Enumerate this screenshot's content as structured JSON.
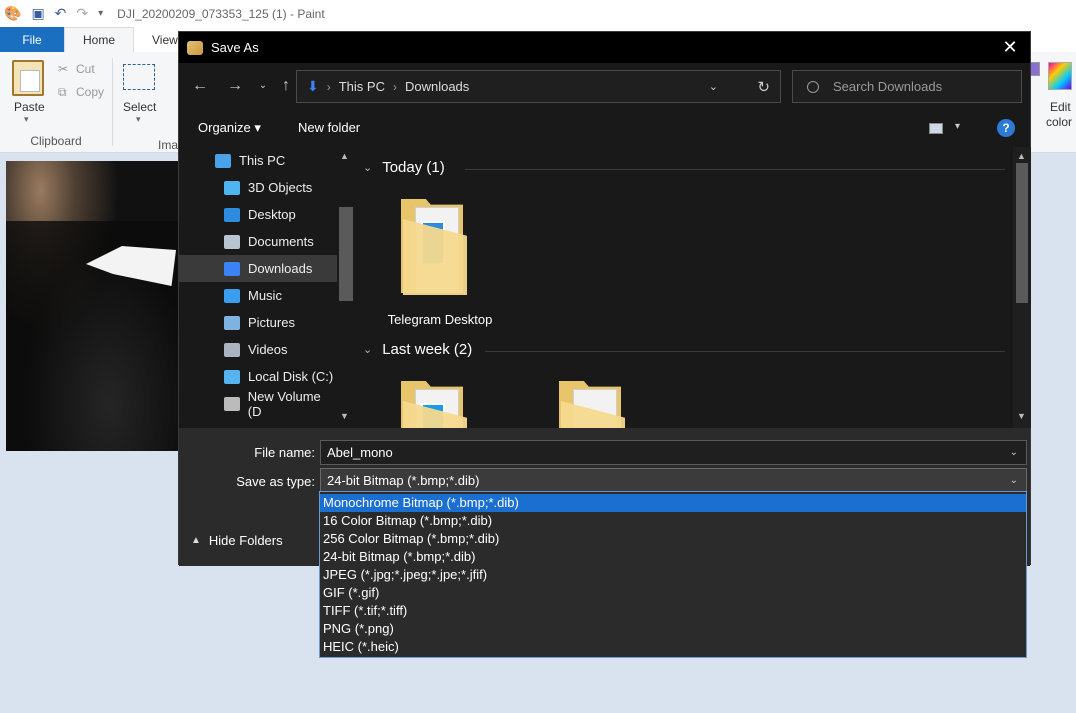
{
  "paint": {
    "title": "DJI_20200209_073353_125 (1) - Paint",
    "tabs": [
      {
        "label": "File"
      },
      {
        "label": "Home"
      },
      {
        "label": "View"
      }
    ],
    "clipboard": {
      "paste": "Paste",
      "cut": "Cut",
      "copy": "Copy",
      "group": "Clipboard"
    },
    "image": {
      "select": "Select",
      "group_partial": "Ima"
    },
    "edit_colors": [
      "Edit",
      "color"
    ]
  },
  "dialog": {
    "title": "Save As",
    "close_glyph": "✕",
    "breadcrumbs": [
      "This PC",
      "Downloads"
    ],
    "search_placeholder": "Search Downloads",
    "toolbar": {
      "organize": "Organize ▾",
      "new_folder": "New folder",
      "help": "?"
    },
    "nav_items": [
      {
        "label": "This PC",
        "icon": "computer-icon",
        "color": "#4aa3e8"
      },
      {
        "label": "3D Objects",
        "icon": "cube-icon",
        "color": "#4fb5f0"
      },
      {
        "label": "Desktop",
        "icon": "desktop-icon",
        "color": "#2d8be0"
      },
      {
        "label": "Documents",
        "icon": "document-icon",
        "color": "#b8c4d0"
      },
      {
        "label": "Downloads",
        "icon": "download-icon",
        "color": "#3b82f6"
      },
      {
        "label": "Music",
        "icon": "music-icon",
        "color": "#3b9cf0"
      },
      {
        "label": "Pictures",
        "icon": "pictures-icon",
        "color": "#7fb2e0"
      },
      {
        "label": "Videos",
        "icon": "video-icon",
        "color": "#aab4c0"
      },
      {
        "label": "Local Disk (C:)",
        "icon": "drive-icon",
        "color": "#55b4f0"
      },
      {
        "label": "New Volume (D",
        "icon": "drive-icon",
        "color": "#bbbbbb"
      }
    ],
    "groups": [
      {
        "header": "Today (1)",
        "items": [
          {
            "label": "Telegram Desktop"
          }
        ]
      },
      {
        "header": "Last week (2)",
        "items": [
          {
            "label": ""
          },
          {
            "label": ""
          }
        ]
      }
    ],
    "file_name_label": "File name:",
    "file_name_value": "Abel_mono",
    "save_type_label": "Save as type:",
    "save_type_value": "24-bit Bitmap (*.bmp;*.dib)",
    "hide_folders": "Hide Folders",
    "type_options": [
      "Monochrome Bitmap (*.bmp;*.dib)",
      "16 Color Bitmap (*.bmp;*.dib)",
      "256 Color Bitmap (*.bmp;*.dib)",
      "24-bit Bitmap (*.bmp;*.dib)",
      "JPEG (*.jpg;*.jpeg;*.jpe;*.jfif)",
      "GIF (*.gif)",
      "TIFF (*.tif;*.tiff)",
      "PNG (*.png)",
      "HEIC (*.heic)"
    ],
    "highlighted_option": 0,
    "accent": "#1a6fd0"
  }
}
